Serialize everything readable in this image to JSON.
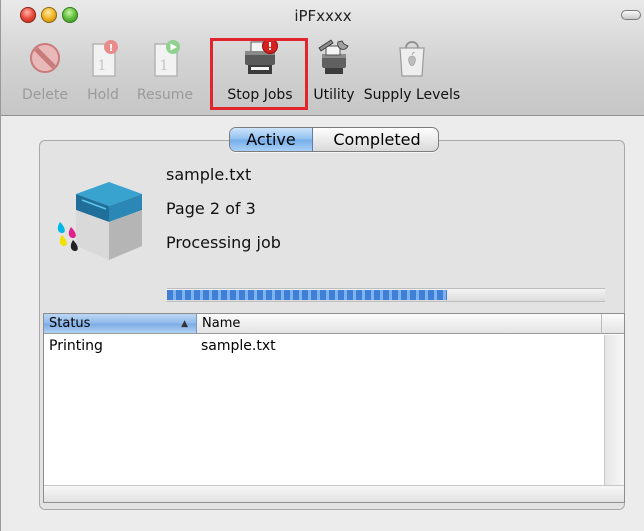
{
  "window": {
    "title": "iPFxxxx"
  },
  "toolbar": {
    "delete_label": "Delete",
    "hold_label": "Hold",
    "resume_label": "Resume",
    "stop_jobs_label": "Stop Jobs",
    "utility_label": "Utility",
    "supply_levels_label": "Supply Levels",
    "page_badge": "1"
  },
  "tabs": {
    "active_label": "Active",
    "completed_label": "Completed"
  },
  "job": {
    "filename": "sample.txt",
    "page_text": "Page 2 of 3",
    "status_text": "Processing job",
    "progress": 0.64
  },
  "table": {
    "columns": [
      "Status",
      "Name"
    ],
    "sort_indicator": "▲",
    "rows": [
      {
        "status": "Printing",
        "name": "sample.txt"
      }
    ]
  },
  "colors": {
    "highlight": "#e0262c",
    "selection_blue": "#8fb9ea",
    "progress_blue": "#3f7fd6"
  },
  "icons": [
    "close-icon",
    "minimize-icon",
    "zoom-icon",
    "toolbar-toggle-icon",
    "delete-icon",
    "hold-icon",
    "resume-icon",
    "stop-jobs-icon",
    "utility-icon",
    "supply-levels-icon",
    "printer-icon",
    "sort-ascending-icon"
  ]
}
